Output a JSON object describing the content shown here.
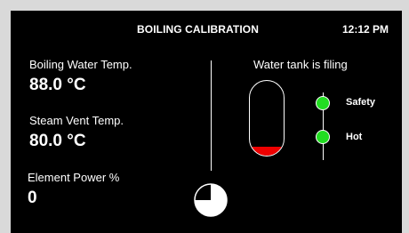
{
  "header": {
    "title": "BOILING CALIBRATION",
    "clock": "12:12 PM"
  },
  "readings": {
    "boiling": {
      "label": "Boiling Water Temp.",
      "value": "88.0 °C"
    },
    "steam": {
      "label": "Steam Vent Temp.",
      "value": "80.0 °C"
    },
    "power": {
      "label": "Element Power %",
      "value": "0"
    }
  },
  "tank": {
    "status": "Water tank is filing",
    "level": 0.12,
    "fill_color": "#ee0000"
  },
  "indicators": [
    {
      "label": "Safety",
      "color": "#22dd22",
      "on": true
    },
    {
      "label": "Hot",
      "color": "#22dd22",
      "on": true
    }
  ],
  "cycle": {
    "progress": 0.75,
    "icon": "pie-progress-icon"
  },
  "colors": {
    "background": "#000000",
    "text": "#ffffff",
    "frame": "#d9d9d9"
  }
}
